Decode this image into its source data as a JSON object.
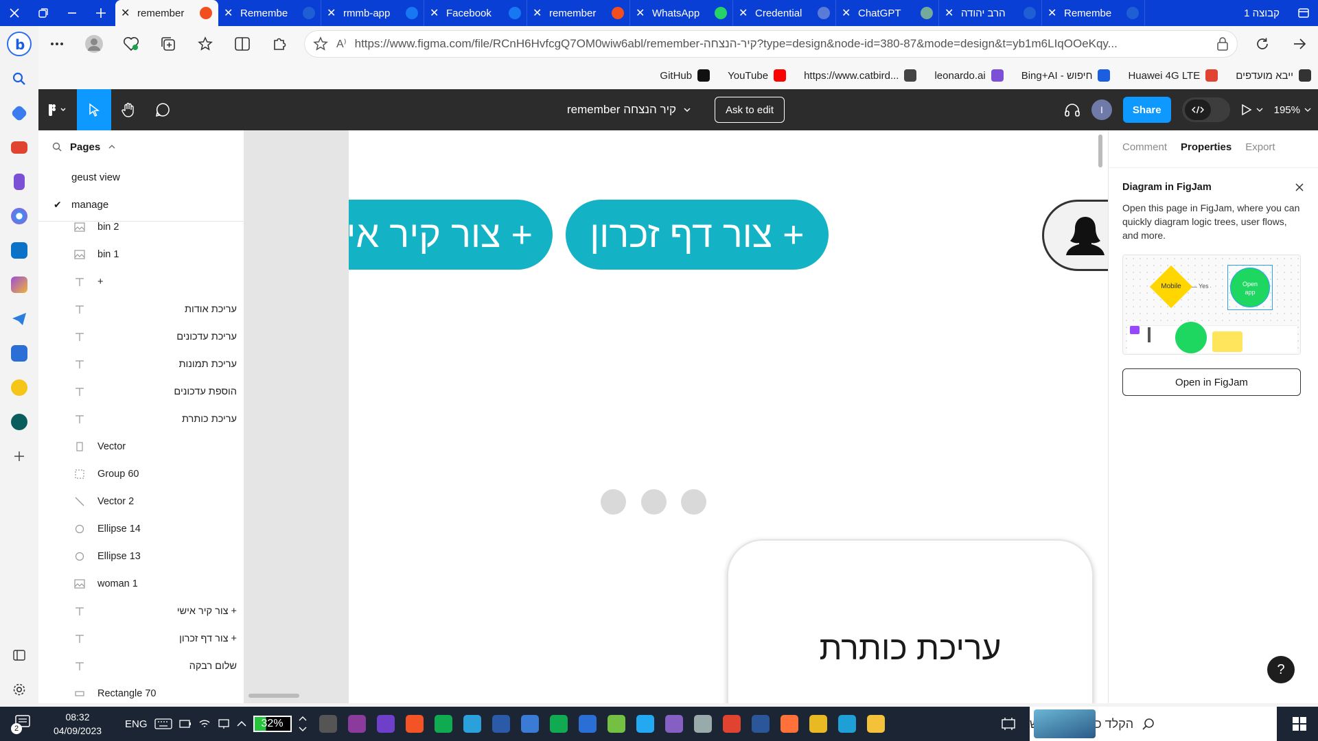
{
  "browser": {
    "tabs": [
      {
        "title": "remember",
        "favicon": "figma-icon",
        "color": "#f24e1e",
        "active": true
      },
      {
        "title": "Remembe",
        "favicon": "info-icon",
        "color": "#1f5fd6"
      },
      {
        "title": "rmmb-app",
        "favicon": "facebook-icon",
        "color": "#1877f2"
      },
      {
        "title": "Facebook",
        "favicon": "facebook-icon",
        "color": "#1877f2"
      },
      {
        "title": "remember",
        "favicon": "figma-icon",
        "color": "#f24e1e"
      },
      {
        "title": "WhatsApp",
        "favicon": "whatsapp-icon",
        "color": "#25d366"
      },
      {
        "title": "Credential",
        "favicon": "key-icon",
        "color": "#5a7bd8"
      },
      {
        "title": "ChatGPT",
        "favicon": "chatgpt-icon",
        "color": "#74aa9c"
      },
      {
        "title": "הרב יהודה",
        "favicon": "info-icon",
        "color": "#1f5fd6"
      },
      {
        "title": "Remembe",
        "favicon": "info-icon",
        "color": "#1f5fd6"
      }
    ],
    "tab_group_label": "קבוצה 1",
    "url": "https://www.figma.com/file/RCnH6HvfcgQ7OM0wiw6abl/remember-קיר-הנצחה?type=design&node-id=380-87&mode=design&t=yb1m6LIqOOeKqy...",
    "favorites": [
      {
        "label": "GitHub",
        "icon": "github-icon"
      },
      {
        "label": "YouTube",
        "icon": "youtube-icon"
      },
      {
        "label": "https://www.catbird...",
        "icon": "catbird-icon"
      },
      {
        "label": "leonardo.ai",
        "icon": "leonardo-icon"
      },
      {
        "label": "Bing+AI - חיפוש",
        "icon": "search-icon"
      },
      {
        "label": "Huawei 4G LTE",
        "icon": "huawei-icon"
      },
      {
        "label": "ייבא מועדפים",
        "icon": "import-favorites-icon"
      }
    ]
  },
  "figma": {
    "file_name": "remember קיר הנצחה",
    "ask_to_edit": "Ask to edit",
    "share": "Share",
    "avatar_initial": "I",
    "zoom": "195%",
    "pages_label": "Pages",
    "pages": [
      {
        "name": "geust view",
        "selected": false
      },
      {
        "name": "manage",
        "selected": true
      }
    ],
    "layers": [
      {
        "name": "bin 2",
        "type": "image"
      },
      {
        "name": "bin 1",
        "type": "image"
      },
      {
        "name": "+",
        "type": "text"
      },
      {
        "name": "עריכת אודות",
        "type": "text",
        "rtl": true
      },
      {
        "name": "עריכת עדכונים",
        "type": "text",
        "rtl": true
      },
      {
        "name": "עריכת תמונות",
        "type": "text",
        "rtl": true
      },
      {
        "name": "הוספת עדכונים",
        "type": "text",
        "rtl": true
      },
      {
        "name": "עריכת כותרת",
        "type": "text",
        "rtl": true
      },
      {
        "name": "Vector",
        "type": "vector"
      },
      {
        "name": "Group 60",
        "type": "group"
      },
      {
        "name": "Vector 2",
        "type": "line"
      },
      {
        "name": "Ellipse 14",
        "type": "ellipse"
      },
      {
        "name": "Ellipse 13",
        "type": "ellipse"
      },
      {
        "name": "woman 1",
        "type": "image"
      },
      {
        "name": "+ צור קיר אישי",
        "type": "text",
        "rtl": true
      },
      {
        "name": "+ צור דף זכרון",
        "type": "text",
        "rtl": true
      },
      {
        "name": "שלום רבקה",
        "type": "text",
        "rtl": true
      },
      {
        "name": "Rectangle 70",
        "type": "rect"
      }
    ],
    "canvas": {
      "button_personal_wall": "+ צור קיר אישי",
      "button_memorial_page": "+ צור דף זכרון",
      "edit_card_title": "עריכת כותרת"
    },
    "right_panel": {
      "tabs": [
        "Comment",
        "Properties",
        "Export"
      ],
      "active_tab": "Properties",
      "diagram_title": "Diagram in FigJam",
      "diagram_desc": "Open this page in FigJam, where you can quickly diagram logic trees, user flows, and more.",
      "preview_mobile": "Mobile",
      "preview_yes": "Yes",
      "preview_open_app": "Open app",
      "open_button": "Open in FigJam"
    },
    "help": "?"
  },
  "taskbar": {
    "notification_count": "2",
    "time": "08:32",
    "date": "04/09/2023",
    "lang": "ENG",
    "battery": "32%",
    "search_placeholder": "הקלד כאן כדי לחפש"
  },
  "colors": {
    "tabstrip": "#0a3fd6",
    "figma_accent": "#0d99ff",
    "pill_teal": "#13b2c5",
    "figjam_green": "#1ed760",
    "figjam_yellow": "#ffd600"
  }
}
